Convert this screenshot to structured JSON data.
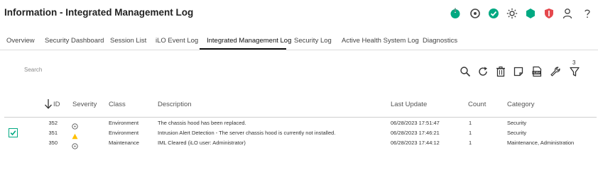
{
  "page": {
    "title": "Information - Integrated Management Log"
  },
  "header_icons": [
    "power-icon",
    "uid-indicator-icon",
    "health-ok-icon",
    "sun-icon",
    "hexagon-icon",
    "shield-icon",
    "user-icon",
    "help-icon"
  ],
  "tabs": [
    {
      "label": "Overview",
      "active": false
    },
    {
      "label": "Security Dashboard",
      "active": false
    },
    {
      "label": "Session List",
      "active": false
    },
    {
      "label": "iLO Event Log",
      "active": false
    },
    {
      "label": "Integrated Management Log",
      "active": true
    },
    {
      "label": "Security Log",
      "active": false
    },
    {
      "label": "Active Health System Log",
      "active": false
    },
    {
      "label": "Diagnostics",
      "active": false
    }
  ],
  "search": {
    "placeholder": "Search"
  },
  "toolbar": {
    "icons": [
      "search-icon",
      "refresh-icon",
      "trash-icon",
      "note-icon",
      "csv-export-icon",
      "wrench-icon",
      "filter-icon"
    ],
    "filter_count": "3"
  },
  "table": {
    "columns": [
      "ID",
      "Severity",
      "Class",
      "Description",
      "Last Update",
      "Count",
      "Category"
    ],
    "rows": [
      {
        "id": "352",
        "severity": "informational",
        "class": "Environment",
        "description": "The chassis hood has been replaced.",
        "last_update": "06/28/2023 17:51:47",
        "count": "1",
        "category": "Security",
        "selected": false
      },
      {
        "id": "351",
        "severity": "caution",
        "class": "Environment",
        "description": "Intrusion Alert Detection - The server chassis hood is currently not installed.",
        "last_update": "06/28/2023 17:46:21",
        "count": "1",
        "category": "Security",
        "selected": true
      },
      {
        "id": "350",
        "severity": "informational",
        "class": "Maintenance",
        "description": "IML Cleared (iLO user: Administrator)",
        "last_update": "06/28/2023 17:44:12",
        "count": "1",
        "category": "Maintenance, Administration",
        "selected": false
      }
    ]
  },
  "colors": {
    "ok_green": "#01a982",
    "caution_yellow": "#ffc000",
    "critical_red": "#e5484d",
    "text_dark": "#222222"
  }
}
